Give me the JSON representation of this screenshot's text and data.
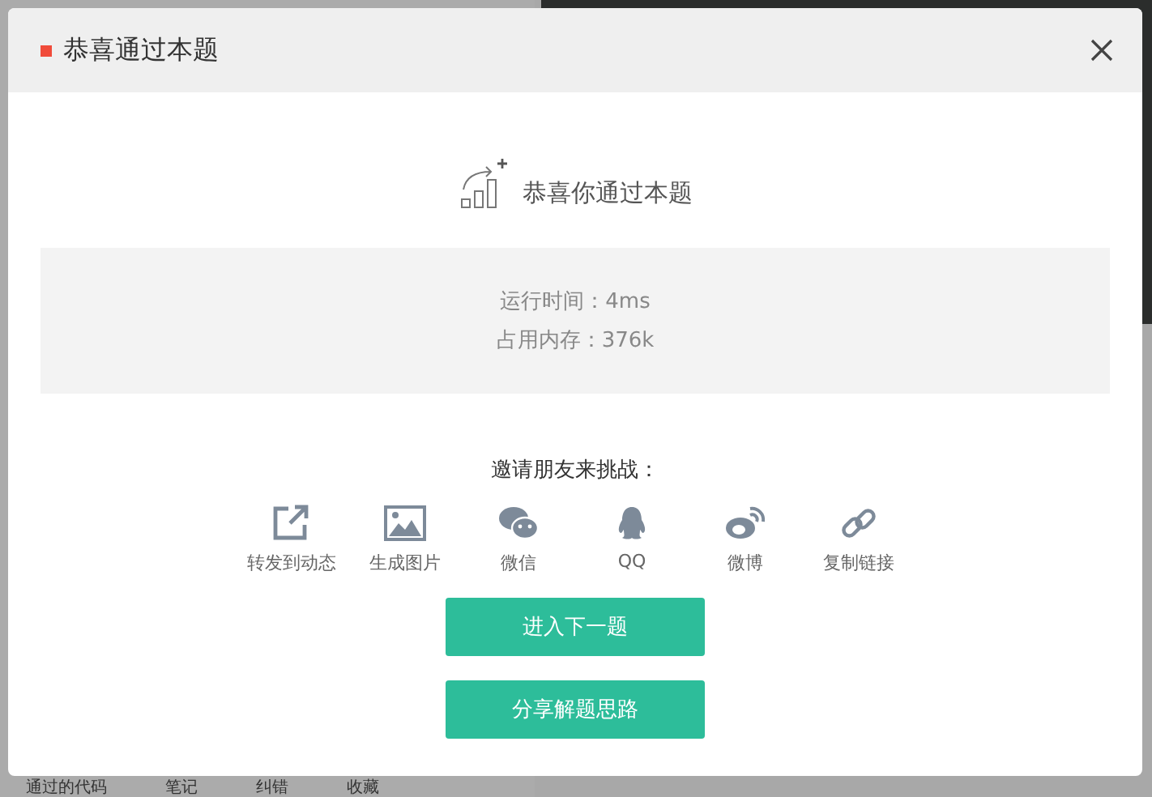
{
  "dialog": {
    "title": "恭喜通过本题",
    "headline": "恭喜你通过本题",
    "stats": [
      "运行时间：4ms",
      "占用内存：376k"
    ],
    "invite_label": "邀请朋友来挑战：",
    "share_options": [
      {
        "kind": "forward",
        "label": "转发到动态"
      },
      {
        "kind": "image",
        "label": "生成图片"
      },
      {
        "kind": "wechat",
        "label": "微信"
      },
      {
        "kind": "qq",
        "label": "QQ"
      },
      {
        "kind": "weibo",
        "label": "微博"
      },
      {
        "kind": "link",
        "label": "复制链接"
      }
    ],
    "buttons": [
      "进入下一题",
      "分享解题思路"
    ]
  },
  "background_bar": [
    "通过的代码",
    "笔记",
    "纠错",
    "收藏"
  ]
}
